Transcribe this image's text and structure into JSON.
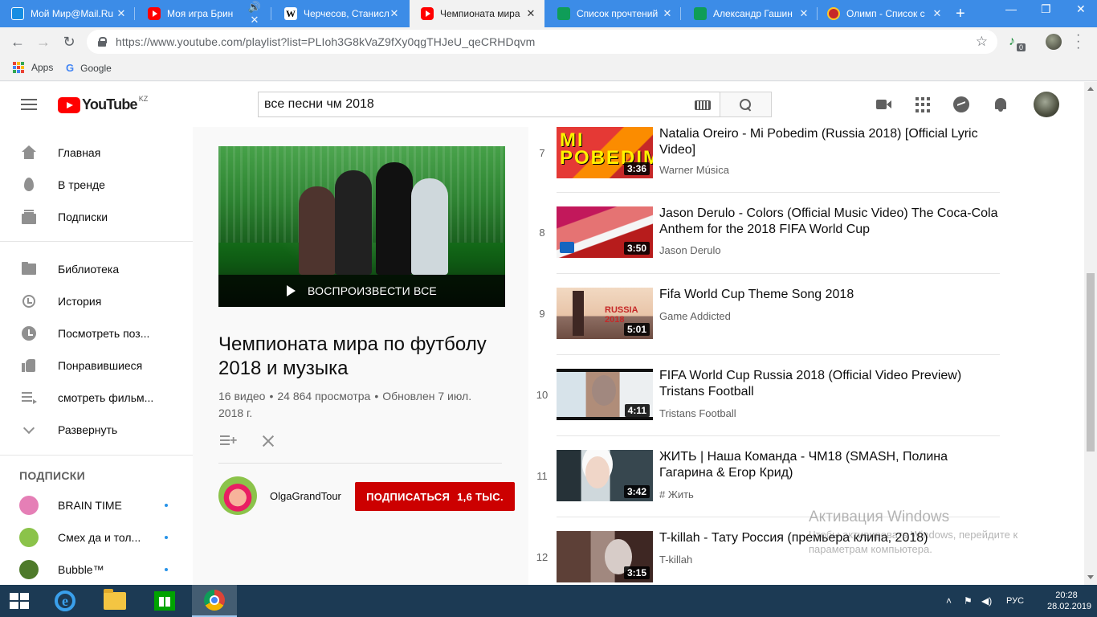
{
  "browser": {
    "tabs": [
      {
        "title": "Мой Мир@Mail.Ru",
        "favicon": "mail-icon",
        "active": false
      },
      {
        "title": "Моя игра Брин",
        "favicon": "youtube-icon",
        "active": false
      },
      {
        "title": "Черчесов, Станисл",
        "favicon": "wikipedia-icon",
        "active": false
      },
      {
        "title": "Чемпионата мира",
        "favicon": "youtube-icon",
        "active": true
      },
      {
        "title": "Список прочтений",
        "favicon": "sheets-icon",
        "active": false
      },
      {
        "title": "Александр Гашин",
        "favicon": "sheets-icon",
        "active": false
      },
      {
        "title": "Олимп - Список с",
        "favicon": "olymp-icon",
        "active": false
      }
    ],
    "url": "https://www.youtube.com/playlist?list=PLIoh3G8kVaZ9fXy0qgTHJeU_qeCRHDqvm",
    "extension_badge": "0",
    "bookmarks": [
      {
        "label": "Apps",
        "icon": "apps-icon"
      },
      {
        "label": "Google",
        "icon": "google-icon"
      }
    ]
  },
  "youtube": {
    "logo_word": "YouTube",
    "country_code": "KZ",
    "search_value": "все песни чм 2018",
    "colors": {
      "brand_red": "#ff0000",
      "subscribe_red": "#cc0000",
      "muted_text": "#606060"
    }
  },
  "sidebar": {
    "main_items": [
      {
        "label": "Главная",
        "icon": "home-icon"
      },
      {
        "label": "В тренде",
        "icon": "fire-icon"
      },
      {
        "label": "Подписки",
        "icon": "subscriptions-icon"
      }
    ],
    "library_items": [
      {
        "label": "Библиотека",
        "icon": "library-icon"
      },
      {
        "label": "История",
        "icon": "history-icon"
      },
      {
        "label": "Посмотреть поз...",
        "icon": "clock-icon"
      },
      {
        "label": "Понравившиеся",
        "icon": "like-icon"
      },
      {
        "label": "смотреть фильм...",
        "icon": "playlist-icon"
      },
      {
        "label": "Развернуть",
        "icon": "chevron-down-icon"
      }
    ],
    "subscriptions_heading": "ПОДПИСКИ",
    "subscriptions": [
      {
        "label": "BRAIN TIME",
        "color": "#e57fb6"
      },
      {
        "label": "Смех да и тол...",
        "color": "#8bc34a"
      },
      {
        "label": "Bubble™",
        "color": "#4e7a2a"
      }
    ]
  },
  "playlist": {
    "play_all_label": "ВОСПРОИЗВЕСТИ ВСЕ",
    "title": "Чемпионата мира по футболу 2018 и музыка",
    "video_count": "16 видео",
    "views": "24 864 просмотра",
    "updated": "Обновлен 7 июл. 2018 г.",
    "stat_sep": "•",
    "owner_name": "OlgaGrandTour",
    "subscribe_label": "ПОДПИСАТЬСЯ",
    "subscriber_count": "1,6 ТЫС."
  },
  "videos": [
    {
      "index": "7",
      "title": "Natalia Oreiro - Mi Pobedim (Russia 2018) [Official Lyric Video]",
      "channel": "Warner Música",
      "duration": "3:36",
      "thumb_text": "MI POBEDIM"
    },
    {
      "index": "8",
      "title": "Jason Derulo - Colors (Official Music Video) The Coca-Cola Anthem for the 2018 FIFA World Cup",
      "channel": "Jason Derulo",
      "duration": "3:50"
    },
    {
      "index": "9",
      "title": "Fifa World Cup Theme Song 2018",
      "channel": "Game Addicted",
      "duration": "5:01",
      "thumb_text": "RUSSIA 2018"
    },
    {
      "index": "10",
      "title": "FIFA World Cup Russia 2018 (Official Video Preview) Tristans Football",
      "channel": "Tristans Football",
      "duration": "4:11"
    },
    {
      "index": "11",
      "title": "ЖИТЬ | Наша Команда - ЧМ18 (SMASH, Полина Гагарина & Егор Крид)",
      "channel": "# Жить",
      "duration": "3:42"
    },
    {
      "index": "12",
      "title": "T-killah - Тату Россия (премьера клипа, 2018)",
      "channel": "T-killah",
      "duration": "3:15"
    }
  ],
  "watermark": {
    "title": "Активация Windows",
    "subtitle": "Чтобы активировать Windows, перейдите к параметрам компьютера."
  },
  "taskbar": {
    "apps": [
      "ie-icon",
      "explorer-icon",
      "store-icon",
      "chrome-icon"
    ],
    "language": "РУС",
    "time": "20:28",
    "date": "28.02.2019"
  }
}
